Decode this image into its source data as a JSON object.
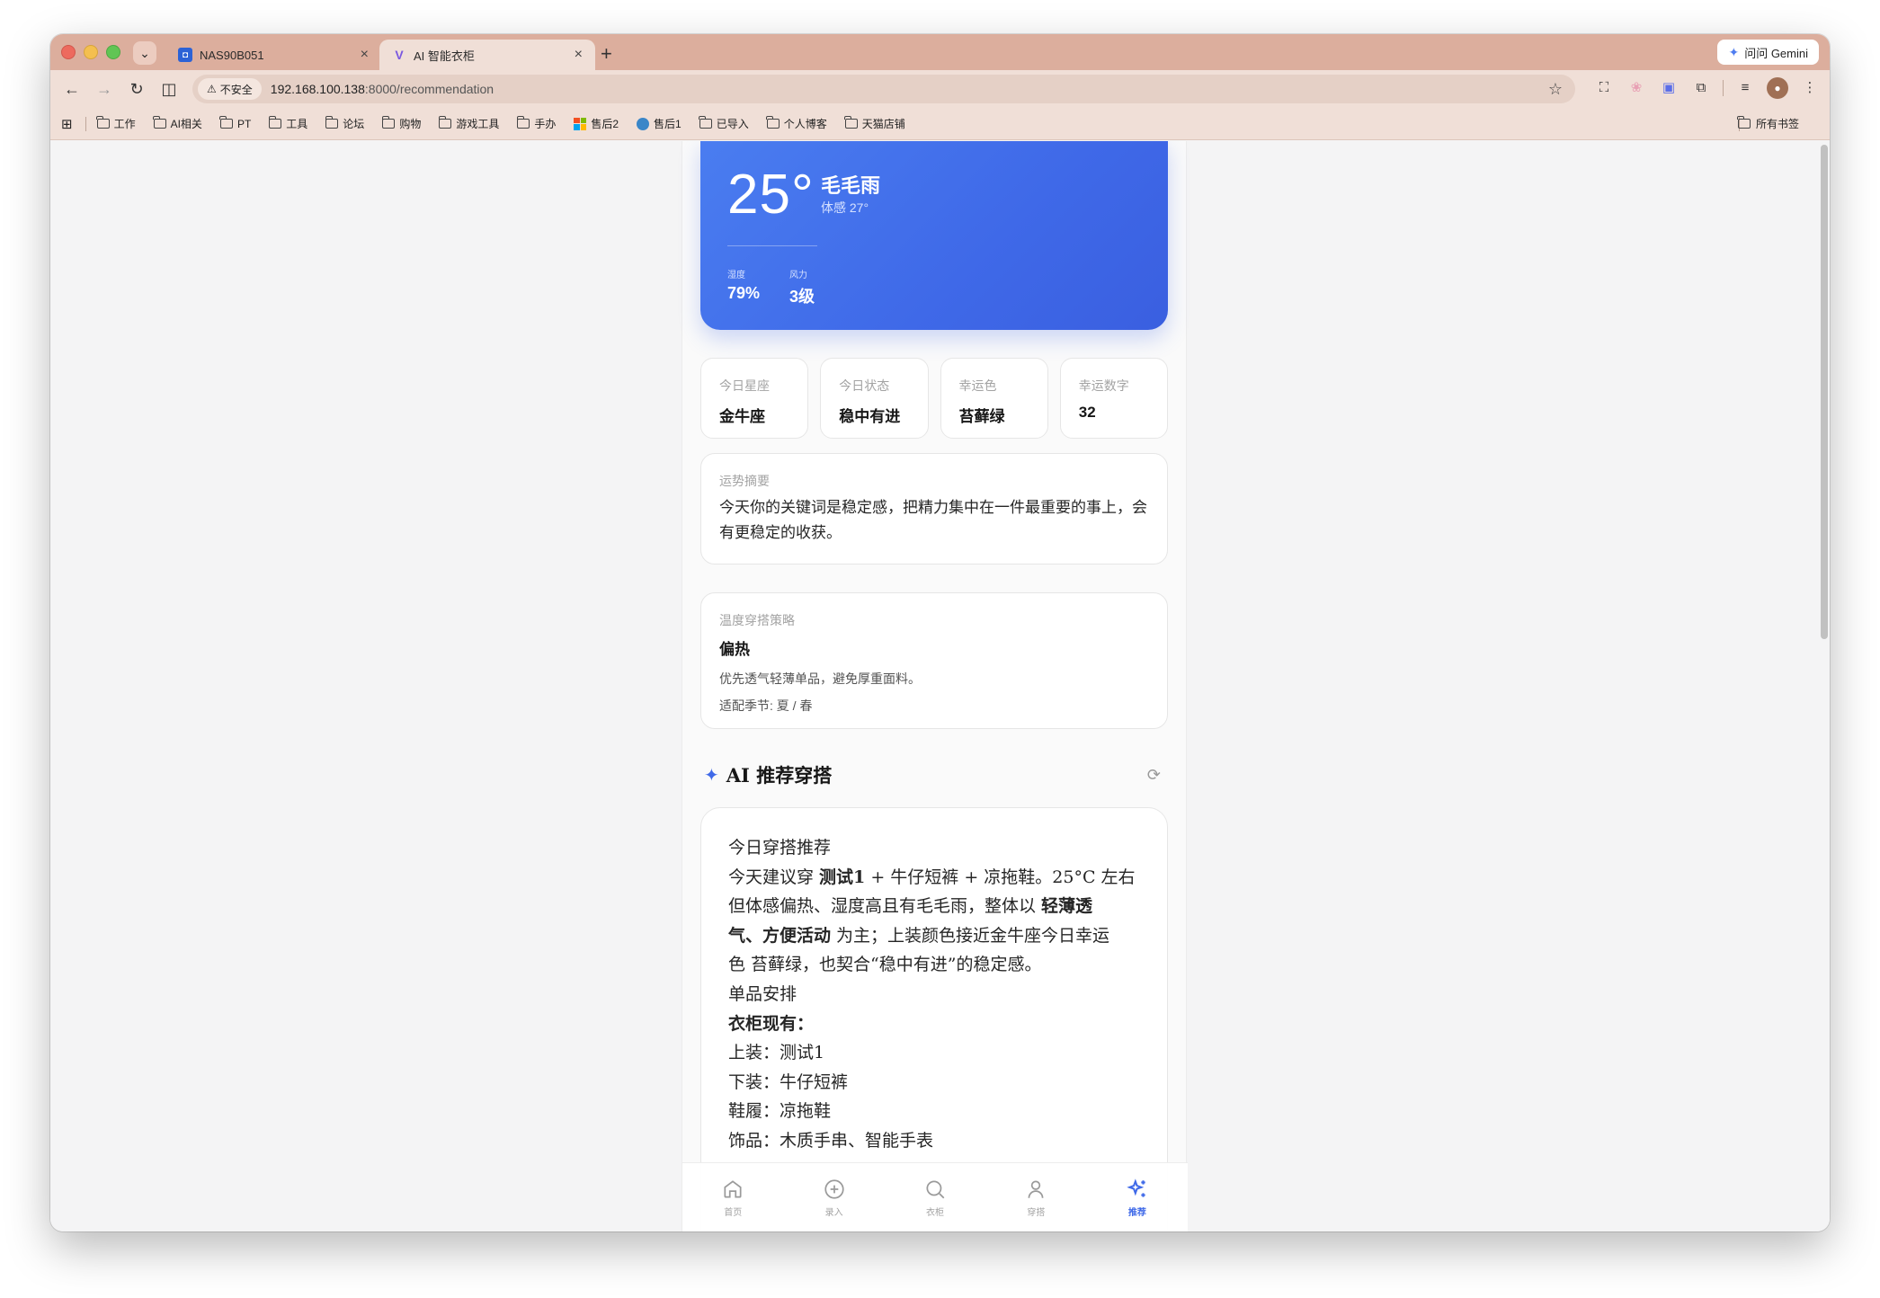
{
  "browser": {
    "tabs": [
      {
        "title": "NAS90B051",
        "favicon": "nas-icon"
      },
      {
        "title": "AI 智能衣柜",
        "favicon": "v-logo-icon",
        "active": true
      }
    ],
    "gemini_label": "问问 Gemini",
    "security_label": "不安全",
    "url_host": "192.168.100.138",
    "url_path": ":8000/recommendation",
    "bookmarks": [
      "工作",
      "AI相关",
      "PT",
      "工具",
      "论坛",
      "购物",
      "游戏工具",
      "手办",
      "售后2",
      "售后1",
      "已导入",
      "个人博客",
      "天猫店铺"
    ],
    "all_bookmarks": "所有书签"
  },
  "weather": {
    "temp": "25°",
    "condition": "毛毛雨",
    "feels": "体感 27°",
    "humidity_label": "湿度",
    "humidity": "79%",
    "wind_label": "风力",
    "wind": "3级"
  },
  "horoscope": [
    {
      "label": "今日星座",
      "value": "金牛座"
    },
    {
      "label": "今日状态",
      "value": "稳中有进"
    },
    {
      "label": "幸运色",
      "value": "苔藓绿"
    },
    {
      "label": "幸运数字",
      "value": "32"
    }
  ],
  "fortune": {
    "label": "运势摘要",
    "text": "今天你的关键词是稳定感，把精力集中在一件最重要的事上，会有更稳定的收获。"
  },
  "temp_strategy": {
    "label": "温度穿搭策略",
    "title": "偏热",
    "desc": "优先透气轻薄单品，避免厚重面料。",
    "season": "适配季节: 夏 / 春"
  },
  "ai_section": {
    "title": "AI 推荐穿搭",
    "lines": {
      "heading": "今日穿搭推荐",
      "l1a": "今天建议穿 ",
      "l1b": "测试1",
      "l1c": " + 牛仔短裤 + 凉拖鞋。25°C 左右",
      "l2a": "但体感偏热、湿度高且有毛毛雨，整体以 ",
      "l2b": "轻薄透",
      "l3a": "气、方便活动",
      "l3b": " 为主；上装颜色接近金牛座今日幸运",
      "l4": "色 苔藓绿，也契合“稳中有进”的稳定感。",
      "items_heading": "单品安排",
      "wardrobe": "衣柜现有：",
      "top": "上装：测试1",
      "bottom": "下装：牛仔短裤",
      "shoes": "鞋履：凉拖鞋",
      "acc": "饰品：木质手串、智能手表"
    }
  },
  "bottom_nav": [
    {
      "label": "首页",
      "icon": "home-icon"
    },
    {
      "label": "录入",
      "icon": "plus-circle-icon"
    },
    {
      "label": "衣柜",
      "icon": "search-icon"
    },
    {
      "label": "穿搭",
      "icon": "person-icon"
    },
    {
      "label": "推荐",
      "icon": "sparkles-icon",
      "active": true
    }
  ],
  "colors": {
    "accent": "#3f69e8",
    "tabstrip": "#dcae9d",
    "toolbar": "#f0dfd7"
  }
}
